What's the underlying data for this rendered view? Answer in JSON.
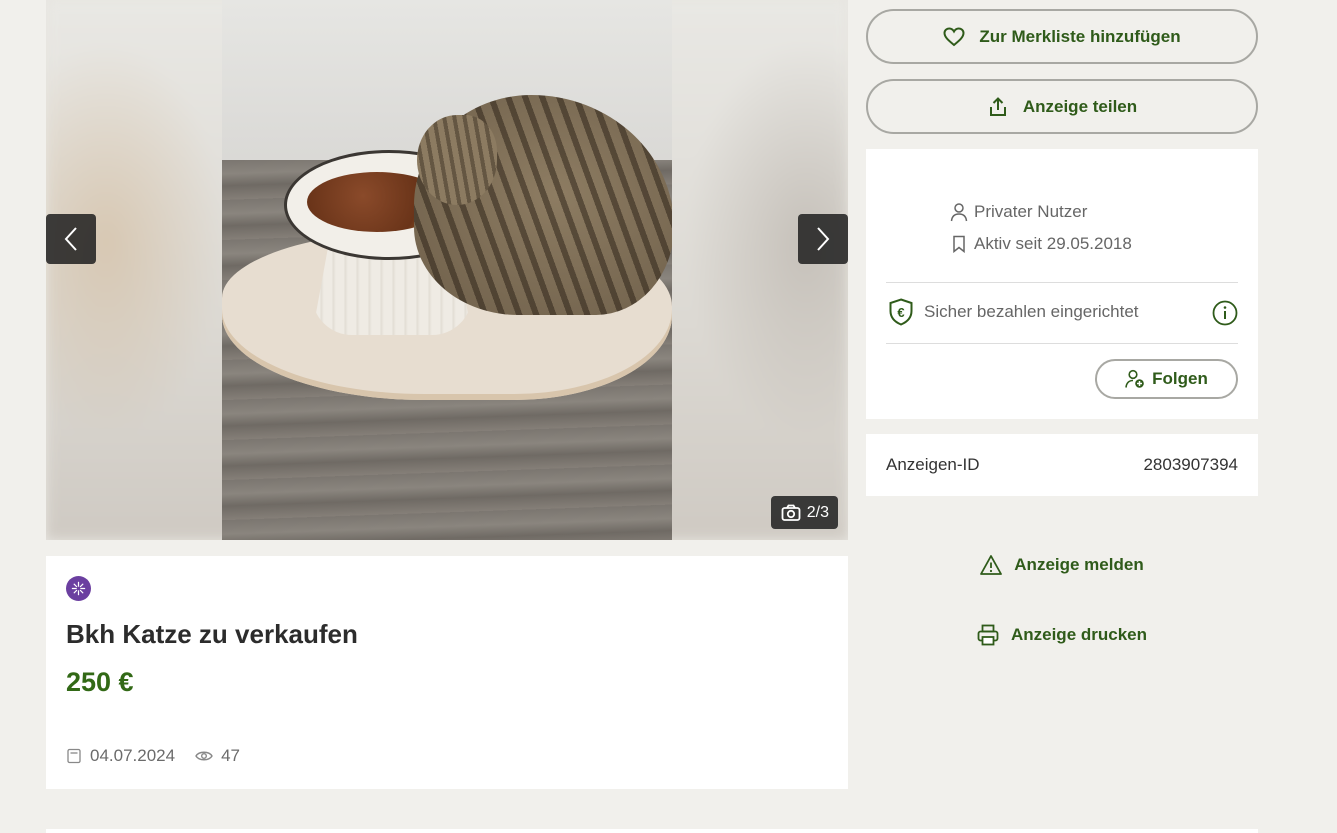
{
  "gallery": {
    "counter": "2/3",
    "prev_icon": "chevron-left-icon",
    "next_icon": "chevron-right-icon",
    "camera_icon": "camera-icon"
  },
  "listing": {
    "title": "Bkh Katze zu verkaufen",
    "price": "250 €",
    "date": "04.07.2024",
    "views": "47",
    "badge_color": "#6b3fa0",
    "price_color": "#326916"
  },
  "actions": {
    "watchlist_label": "Zur Merkliste hinzufügen",
    "share_label": "Anzeige teilen",
    "report_label": "Anzeige melden",
    "print_label": "Anzeige drucken",
    "accent_color": "#2f5b1a"
  },
  "seller": {
    "type": "Privater Nutzer",
    "active_since": "Aktiv seit 29.05.2018",
    "secure_payment": "Sicher bezahlen eingerichtet",
    "follow_label": "Folgen"
  },
  "ad_id": {
    "label": "Anzeigen-ID",
    "value": "2803907394"
  }
}
